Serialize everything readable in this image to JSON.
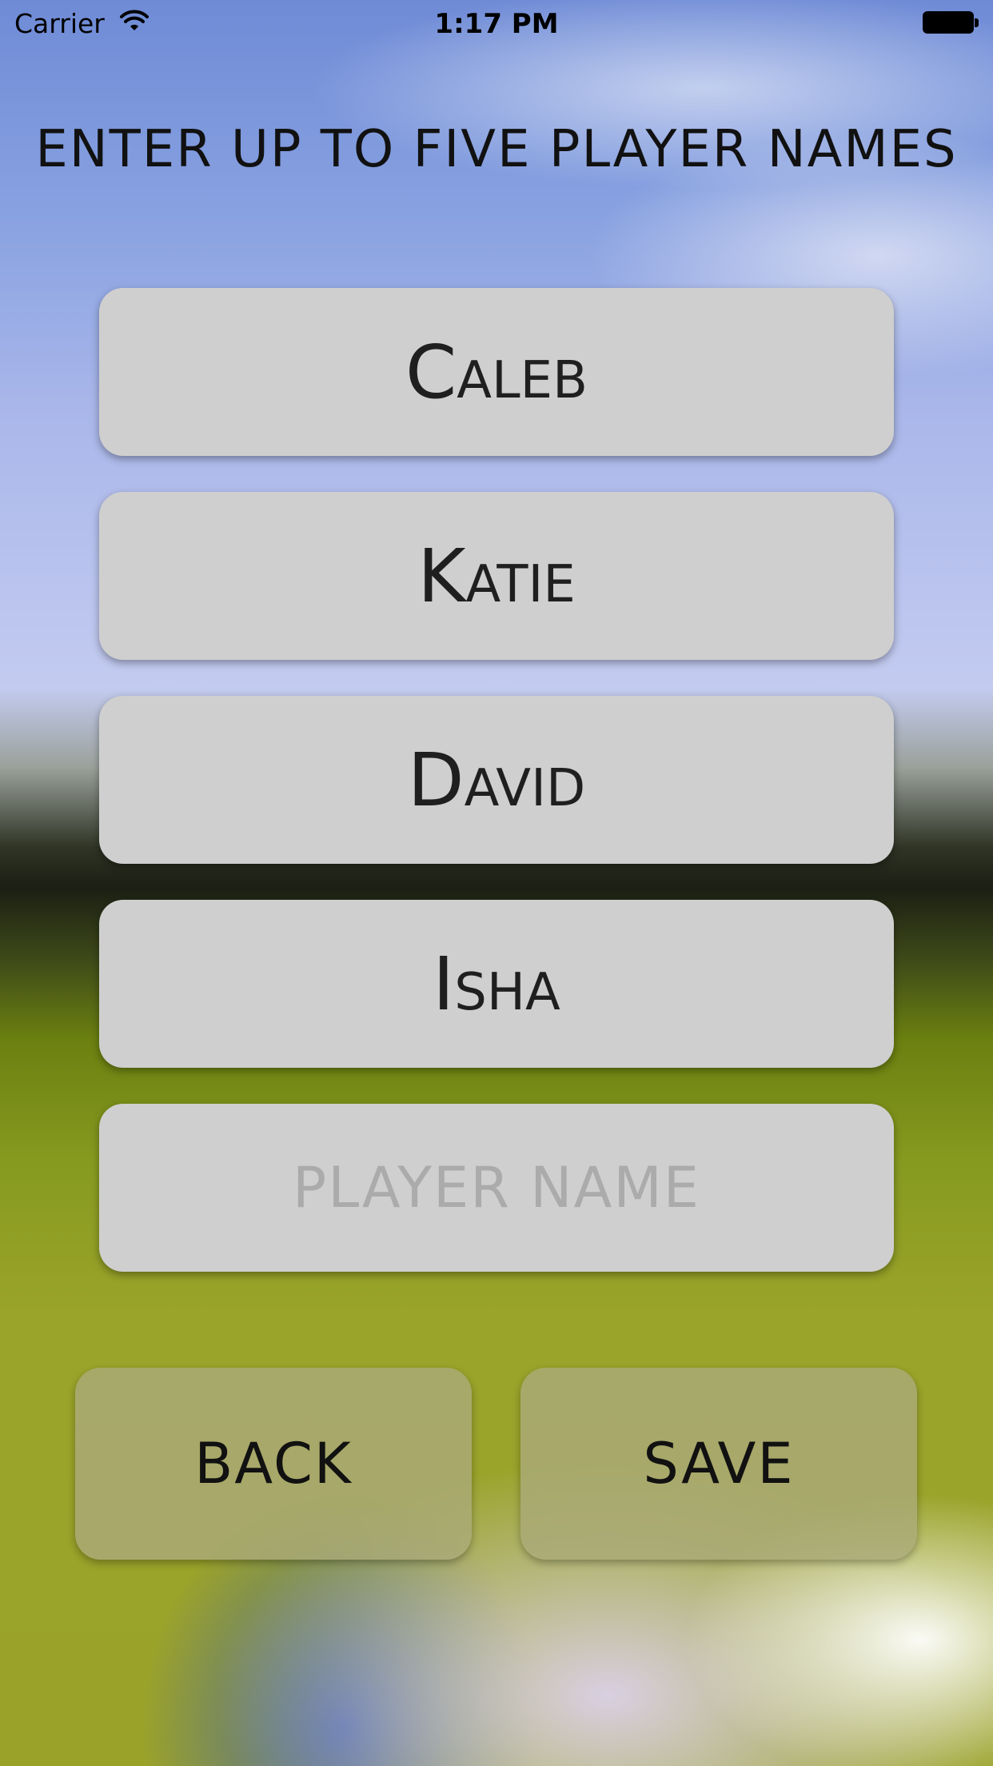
{
  "status_bar": {
    "carrier": "Carrier",
    "time": "1:17 PM",
    "icons": [
      "wifi-icon",
      "battery-icon"
    ]
  },
  "screen": {
    "title": "ENTER UP TO FIVE PLAYER NAMES"
  },
  "players": [
    {
      "value": "Caleb",
      "placeholder": "PLAYER NAME"
    },
    {
      "value": "Katie",
      "placeholder": "PLAYER NAME"
    },
    {
      "value": "David",
      "placeholder": "PLAYER NAME"
    },
    {
      "value": "Isha",
      "placeholder": "PLAYER NAME"
    },
    {
      "value": "",
      "placeholder": "PLAYER NAME"
    }
  ],
  "buttons": {
    "back_label": "BACK",
    "save_label": "SAVE"
  },
  "colors": {
    "field_bg": "#cfcfcf",
    "button_bg": "#aaaa78",
    "text": "#111111",
    "placeholder": "#ababab"
  }
}
